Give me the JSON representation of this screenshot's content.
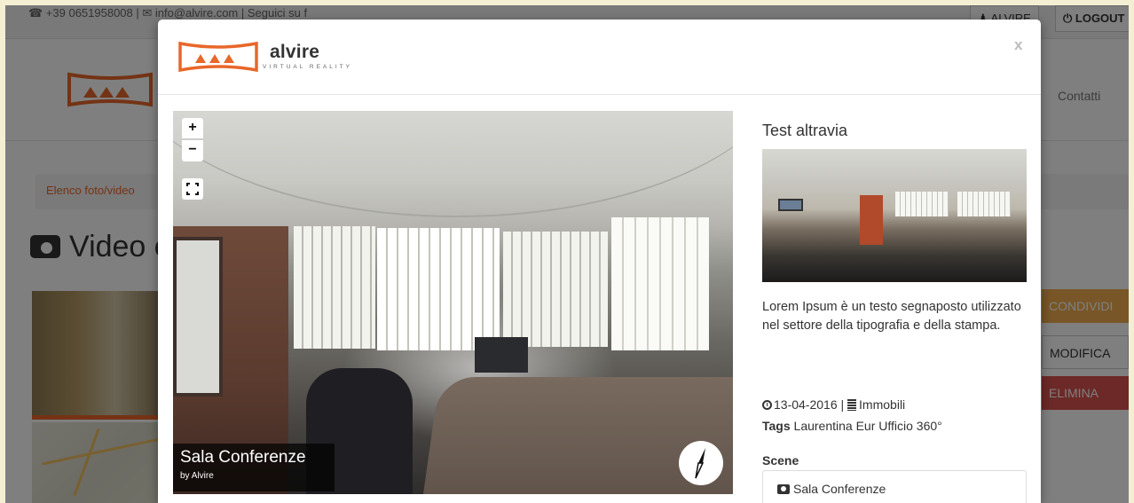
{
  "background_page": {
    "topbar_contact": "☎ +39 0651958008 | ✉ info@alvire.com | Seguici su f",
    "user_button": "♟ ALVIRE",
    "logout_button": "⏻ LOGOUT",
    "nav_contatti": "Contatti",
    "breadcrumb": "Elenco foto/video",
    "page_title": "Video e",
    "buttons": {
      "condividi": "CONDIVIDI",
      "modifica": "MODIFICA",
      "elimina": "ELIMINA"
    }
  },
  "modal": {
    "brand_name": "alvire",
    "brand_tagline": "VIRTUAL REALITY",
    "close_label": "x",
    "viewer": {
      "zoom_in": "+",
      "zoom_out": "−",
      "scene_title": "Sala Conferenze",
      "scene_author": "by Alvire"
    },
    "info": {
      "title": "Test altravia",
      "description": "Lorem Ipsum è un testo segnaposto utilizzato nel settore della tipografia e della stampa.",
      "date": "13-04-2016",
      "separator": " | ",
      "category": "Immobili",
      "tags_label": "Tags",
      "tags_value": " Laurentina Eur Ufficio 360°",
      "scenes_heading": "Scene",
      "scenes": [
        {
          "label": "Sala Conferenze"
        }
      ]
    }
  },
  "colors": {
    "brand_orange": "#e8672a",
    "warning": "#f0ad4e",
    "danger": "#d9534f"
  }
}
